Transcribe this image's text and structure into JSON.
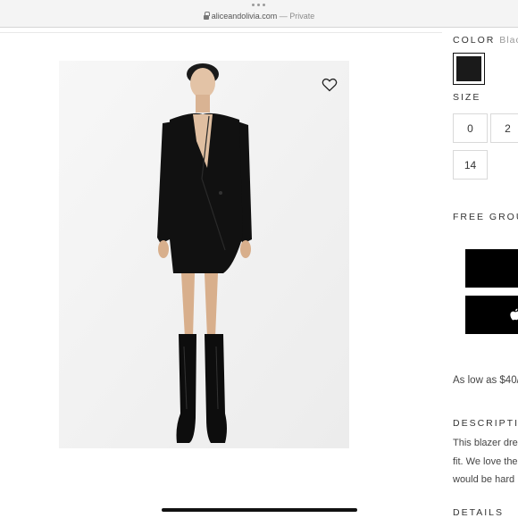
{
  "browser": {
    "url": "aliceandolivia.com",
    "separator": " — ",
    "privacy": "Private"
  },
  "product": {
    "image_icon": "heart-icon",
    "color": {
      "label": "COLOR",
      "value": "Black",
      "swatch_hex": "#1a1a1a"
    },
    "size": {
      "label": "SIZE",
      "options": [
        "0",
        "2",
        "14"
      ]
    },
    "shipping_label": "FREE GROUN",
    "buttons": [
      {
        "name": "add-to-bag-button",
        "icon": ""
      },
      {
        "name": "apple-pay-button",
        "icon": "apple-icon"
      }
    ],
    "financing_text": "As low as $40/",
    "description": {
      "heading": "DESCRIPTIC",
      "lines": [
        "This blazer dre",
        "fit. We love the",
        "would be hard"
      ]
    },
    "details_heading": "DETAILS"
  },
  "colors": {
    "accent": "#000000",
    "border": "#d9d9d9",
    "muted": "#999999"
  }
}
